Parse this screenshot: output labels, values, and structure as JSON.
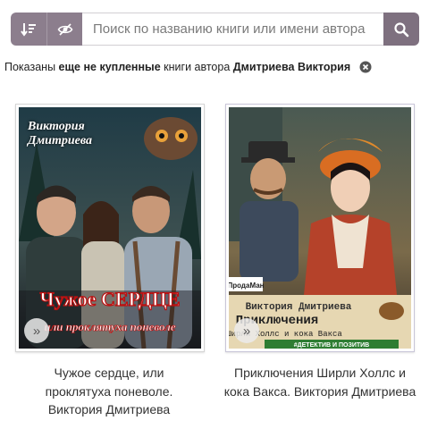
{
  "search": {
    "placeholder": "Поиск по названию книги или имени автора"
  },
  "filter": {
    "prefix": "Показаны",
    "emphasis": "еще не купленные",
    "middle": "книги автора",
    "author": "Дмитриева Виктория"
  },
  "books": [
    {
      "caption": "Чужое сердце, или проклятуха поневоле. Виктория Дмитриева",
      "cover_author": "Виктория Дмитриева",
      "cover_title": "Чужое СЕРДЦЕ",
      "cover_subtitle": "или проклятуха поневоле"
    },
    {
      "caption": "Приключения Ширли Холлс и кока Вакса. Виктория Дмитриева",
      "cover_author": "Виктория Дмитриева",
      "cover_title": "Приключения",
      "cover_subtitle": "Ширли Холлс и кока Вакса",
      "cover_publisher": "ПродаМан",
      "cover_tags": "#ДЕТЕКТИВ И ПОЗИТИВ"
    }
  ],
  "more_label": "»",
  "colors": {
    "toolbar": "#8c7e8d",
    "search_button": "#7e707f",
    "border": "#d2cfd3"
  }
}
